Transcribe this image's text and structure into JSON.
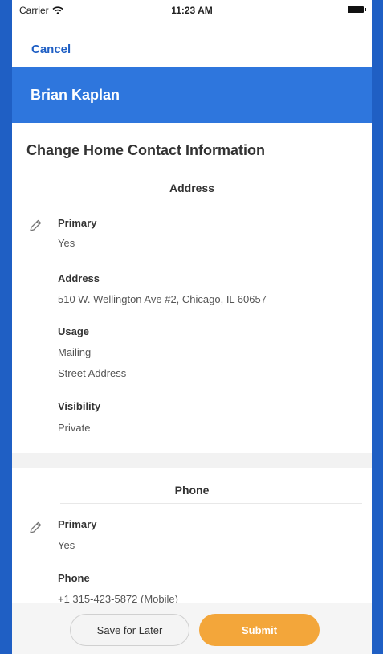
{
  "status_bar": {
    "carrier": "Carrier",
    "time": "11:23 AM"
  },
  "nav": {
    "cancel_label": "Cancel"
  },
  "header": {
    "name": "Brian Kaplan",
    "color": "#2e76dd"
  },
  "form": {
    "title": "Change Home Contact Information",
    "address_section": {
      "heading": "Address",
      "primary_label": "Primary",
      "primary_value": "Yes",
      "address_label": "Address",
      "address_value": "510 W. Wellington Ave #2, Chicago, IL 60657",
      "usage_label": "Usage",
      "usage_values": [
        "Mailing",
        "Street Address"
      ],
      "visibility_label": "Visibility",
      "visibility_value": "Private"
    },
    "phone_section": {
      "heading": "Phone",
      "primary_label": "Primary",
      "primary_value": "Yes",
      "phone_label": "Phone",
      "phone_value": "+1 315-423-5872 (Mobile)"
    }
  },
  "footer": {
    "save_label": "Save for Later",
    "submit_label": "Submit",
    "submit_color": "#f3a63a"
  },
  "icons": {
    "wifi": "wifi-icon",
    "battery": "battery-icon",
    "edit": "pencil-icon"
  }
}
